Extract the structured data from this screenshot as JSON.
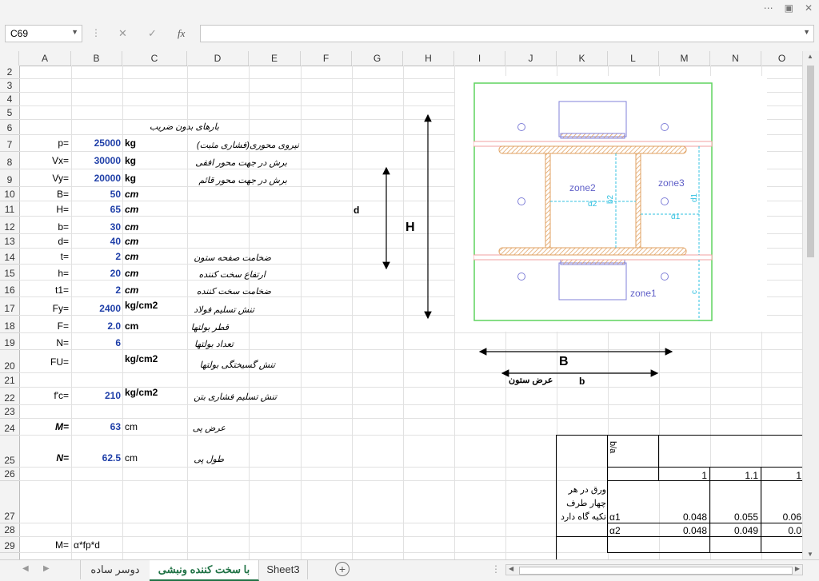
{
  "namebox": {
    "value": "C69"
  },
  "formula": {
    "fx": "fx",
    "value": ""
  },
  "columns": [
    "A",
    "B",
    "C",
    "D",
    "E",
    "F",
    "G",
    "H",
    "I",
    "J",
    "K",
    "L",
    "M",
    "N",
    "O"
  ],
  "rows": [
    "2",
    "3",
    "4",
    "5",
    "6",
    "7",
    "8",
    "9",
    "10",
    "11",
    "12",
    "13",
    "14",
    "15",
    "16",
    "17",
    "18",
    "19",
    "20",
    "21",
    "22",
    "23",
    "24",
    "25",
    "26",
    "27",
    "28",
    "29"
  ],
  "cells": {
    "c6": "بارهای بدون ضریب",
    "labels": {
      "r7": "p=",
      "r8": "Vx=",
      "r9": "Vy=",
      "r10": "B=",
      "r11": "H=",
      "r12": "b=",
      "r13": "d=",
      "r14": "t=",
      "r15": "h=",
      "r16": "t1=",
      "r17": "Fy=",
      "r18": "F=",
      "r19": "N=",
      "r20": "FU=",
      "r22": "f'c=",
      "r24": "M=",
      "r25": "N=",
      "r29": "M="
    },
    "values": {
      "r7": "25000",
      "r8": "30000",
      "r9": "20000",
      "r10": "50",
      "r11": "65",
      "r12": "30",
      "r13": "40",
      "r14": "2",
      "r15": "20",
      "r16": "2",
      "r17": "2400",
      "r18": "2.0",
      "r19": "6",
      "r22": "210",
      "r24": "63",
      "r25": "62.5"
    },
    "units": {
      "r7": "kg",
      "r8": "kg",
      "r9": "kg",
      "r10": "cm",
      "r11": "cm",
      "r12": "cm",
      "r13": "cm",
      "r14": "cm",
      "r15": "cm",
      "r16": "cm",
      "r17": "kg/cm2",
      "r18": "cm",
      "r20": "kg/cm2",
      "r22": "kg/cm2",
      "r24": "cm",
      "r25": "cm"
    },
    "desc": {
      "r7": "نیروی محوری(فشاری مثبت)",
      "r8": "برش در جهت محور افقی",
      "r9": "برش در جهت محور قائم",
      "r14": "ضخامت صفحه ستون",
      "r15": "ارتفاع سخت کننده",
      "r16": "ضخامت سخت کننده",
      "r17": "تنش تسلیم فولاد",
      "r18": "قطر بولتها",
      "r19": "تعداد بولتها",
      "r20": "تنش گسیختگی بولتها",
      "r22": "تنش تسلیم فشاری بتن",
      "r24": "عرض پی",
      "r25": "طول پی"
    },
    "b29": "α*fp*d",
    "g11": "d",
    "h12": "H",
    "j20": "B",
    "j21": "عرض ستون",
    "k21": "b"
  },
  "drawing": {
    "zone1": "zone1",
    "zone2": "zone2",
    "zone3": "zone3",
    "a1": "α1",
    "a2": "α2",
    "b2": "b2",
    "d1": "d1",
    "c": "c"
  },
  "table": {
    "header_cell": "b/a",
    "row26": [
      "1",
      "1.1",
      "1"
    ],
    "row27_label": [
      "ورق در هر",
      "چهار طرف",
      "تکیه گاه دارد"
    ],
    "row27_name": "α1",
    "row27": [
      "0.048",
      "0.055",
      "0.06"
    ],
    "row28_name": "α2",
    "row28": [
      "0.048",
      "0.049",
      "0.0"
    ]
  },
  "tabs": [
    "دوسر ساده",
    "با سخت کننده ونبشی",
    "Sheet3"
  ],
  "active_tab": "با سخت کننده ونبشی"
}
